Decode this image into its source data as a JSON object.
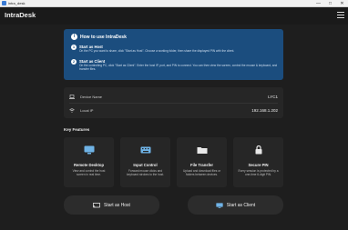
{
  "window": {
    "title": "intra_desk"
  },
  "appbar": {
    "app_name": "IntraDesk"
  },
  "howto": {
    "title": "How to use IntraDesk",
    "steps": [
      {
        "num": "1",
        "title": "Start as Host",
        "desc": "On the PC you want to share, click \"Start as Host\". Choose a working folder, then share the displayed PIN with the client."
      },
      {
        "num": "2",
        "title": "Start as Client",
        "desc": "On the controlling PC, click \"Start as Client\". Enter the host IP, port, and PIN to connect. You can then view the screen, control the mouse & keyboard, and transfer files."
      }
    ]
  },
  "device": {
    "name_label": "Device Name",
    "name_value": "LYC1",
    "ip_label": "Local IP",
    "ip_value": "192.168.1.202"
  },
  "features": {
    "title": "Key Features",
    "items": [
      {
        "title": "Remote Desktop",
        "desc": "View and control the host screen in real time.",
        "icon": "monitor-icon"
      },
      {
        "title": "Input Control",
        "desc": "Forward mouse clicks and keyboard strokes to the host.",
        "icon": "keyboard-icon"
      },
      {
        "title": "File Transfer",
        "desc": "Upload and download files or folders between devices.",
        "icon": "folder-icon"
      },
      {
        "title": "Secure PIN",
        "desc": "Every session is protected by a one-time 6-digit PIN.",
        "icon": "lock-icon"
      }
    ]
  },
  "actions": {
    "host_label": "Start as Host",
    "client_label": "Start as Client"
  },
  "colors": {
    "accent": "#1b4d7e",
    "background": "#1e1e1e",
    "card": "#262626",
    "icon_blue": "#6fb3e6"
  }
}
